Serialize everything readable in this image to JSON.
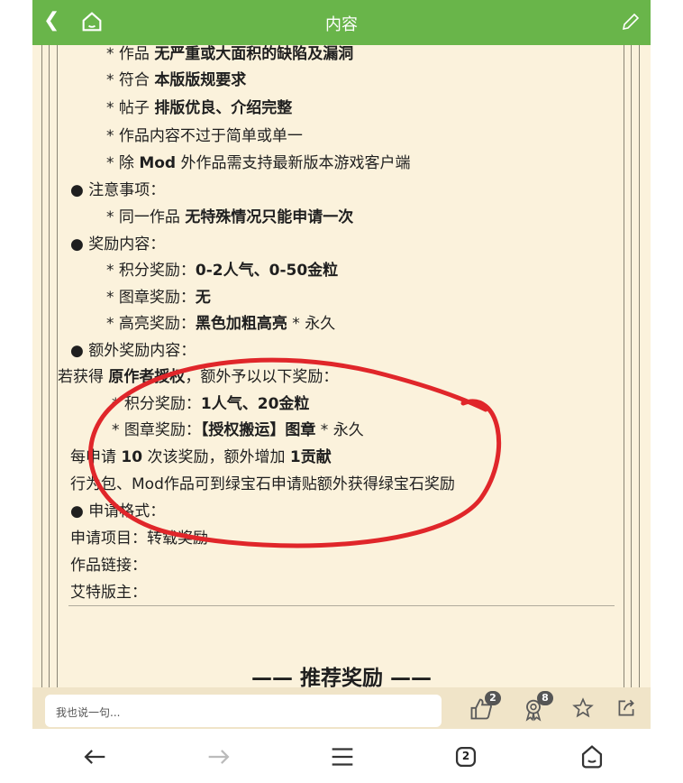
{
  "header": {
    "title": "内容"
  },
  "content": {
    "lines": [
      {
        "prefix": "* 作品 ",
        "bold": "无严重或大面积的缺陷及漏洞"
      },
      {
        "prefix": "* 符合 ",
        "bold": "本版版规要求"
      },
      {
        "prefix": "* 帖子 ",
        "bold": "排版优良、介绍完整"
      },
      {
        "prefix": "* 作品内容不过于简单或单一"
      },
      {
        "prefix": "* 除 ",
        "bold": "Mod",
        "suffix": " 外作品需支持最新版本游戏客户端"
      },
      {
        "prefix": "● 注意事项："
      },
      {
        "prefix": "* 同一作品 ",
        "bold": "无特殊情况只能申请一次"
      },
      {
        "prefix": "● 奖励内容："
      },
      {
        "prefix": "* 积分奖励：",
        "bold": "0-2人气、0-50金粒"
      },
      {
        "prefix": "* 图章奖励：",
        "bold": "无"
      },
      {
        "prefix": "* 高亮奖励：",
        "bold": "黑色加粗高亮",
        "suffix": " * 永久"
      },
      {
        "prefix": "● 额外奖励内容："
      },
      {
        "prefix": "若获得 ",
        "bold": "原作者授权",
        "suffix": "，额外予以以下奖励："
      },
      {
        "prefix": "* 积分奖励：",
        "bold": "1人气、20金粒"
      },
      {
        "prefix": "* 图章奖励：",
        "bold": "【授权搬运】图章",
        "suffix": " * 永久"
      },
      {
        "prefix": "每申请 ",
        "bold": "10",
        "suffix": " 次该奖励，额外增加 ",
        "bold2": "1贡献"
      },
      {
        "prefix": "行为包、Mod作品可到绿宝石申请贴额外获得绿宝石奖励"
      },
      {
        "prefix": "● 申请格式："
      },
      {
        "prefix": "申请项目：转载奖励"
      },
      {
        "prefix": "作品链接："
      },
      {
        "prefix": "艾特版主："
      }
    ],
    "section_heading": "—— 推荐奖励 ——"
  },
  "bottom": {
    "input_placeholder": "我也说一句...",
    "like_count": "2",
    "award_count": "8"
  },
  "navbar": {
    "tabs_count": "2"
  },
  "colors": {
    "header_bg": "#69b54a",
    "page_bg": "#fbf2dc",
    "annotation": "#e0262a"
  }
}
